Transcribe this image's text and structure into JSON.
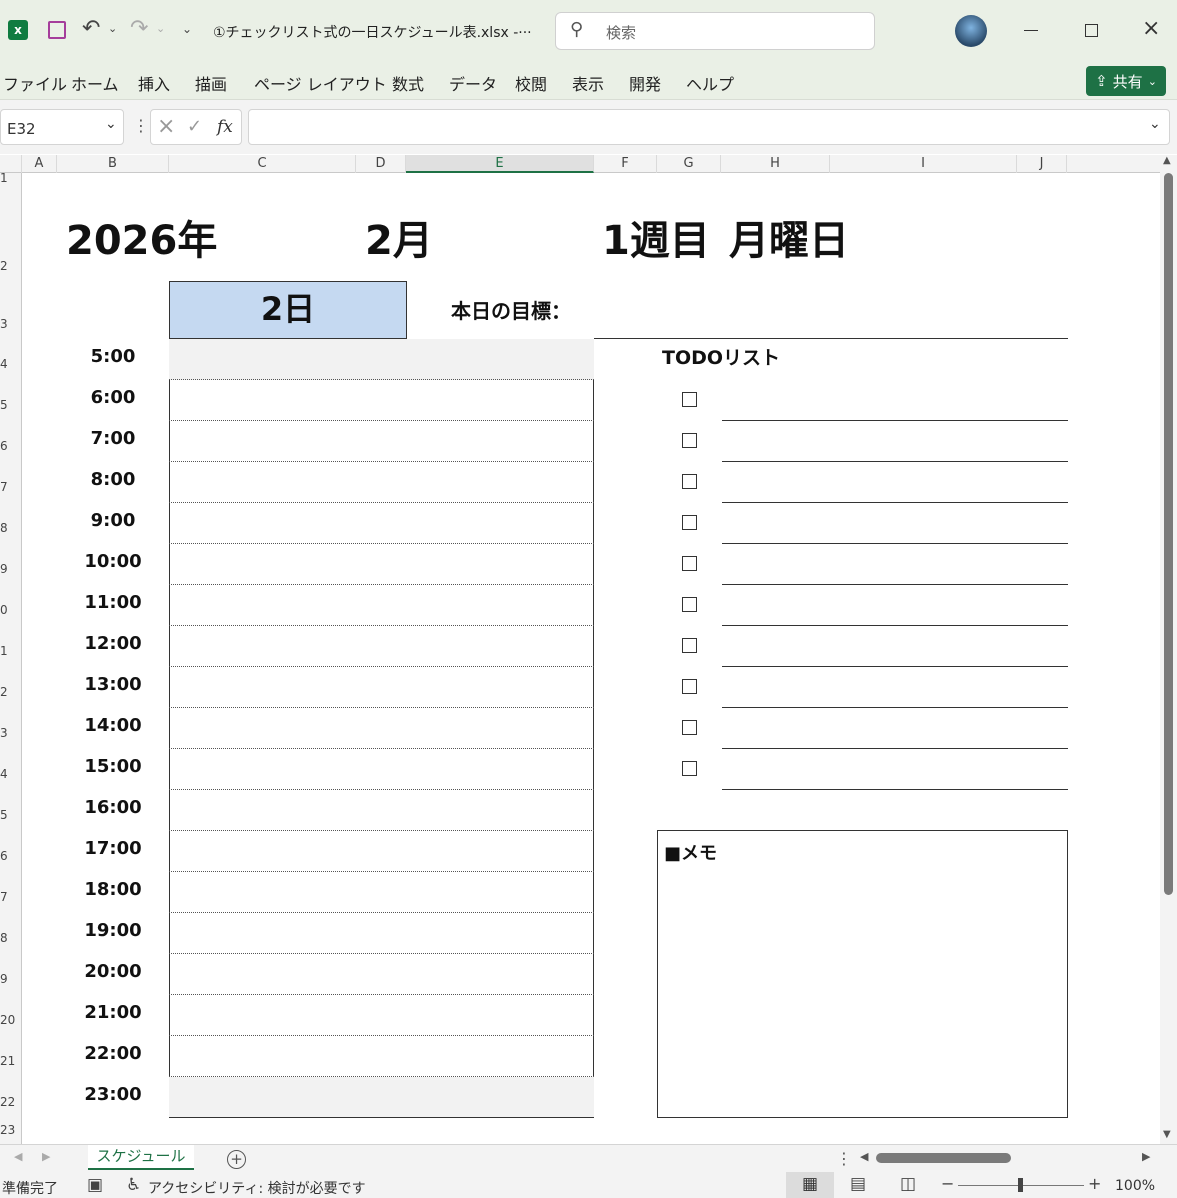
{
  "titlebar": {
    "filename": "①チェックリスト式の一日スケジュール表.xlsx  -···",
    "search_placeholder": "検索"
  },
  "menu": [
    "ファイル",
    "ホーム",
    "挿入",
    "描画",
    "ページ レイアウト",
    "数式",
    "データ",
    "校閲",
    "表示",
    "開発",
    "ヘルプ"
  ],
  "share_label": "共有",
  "formula": {
    "name_box": "E32",
    "fx": "fx"
  },
  "columns": [
    "A",
    "B",
    "C",
    "D",
    "E",
    "F",
    "G",
    "H",
    "I",
    "J"
  ],
  "rows": [
    "1",
    "2",
    "3",
    "4",
    "5",
    "6",
    "7",
    "8",
    "9",
    "0",
    "1",
    "2",
    "3",
    "4",
    "5",
    "6",
    "7",
    "8",
    "9",
    "20",
    "21",
    "22",
    "23"
  ],
  "header": {
    "year": "2026年",
    "month": "2月",
    "week": "1週目",
    "weekday": "月曜日",
    "day": "2日",
    "goal_label": "本日の目標："
  },
  "times": [
    "5:00",
    "6:00",
    "7:00",
    "8:00",
    "9:00",
    "10:00",
    "11:00",
    "12:00",
    "13:00",
    "14:00",
    "15:00",
    "16:00",
    "17:00",
    "18:00",
    "19:00",
    "20:00",
    "21:00",
    "22:00",
    "23:00"
  ],
  "todo": {
    "title": "TODOリスト",
    "count": 10
  },
  "memo_label": "■メモ",
  "sheet_tab": "スケジュール",
  "status": {
    "ready": "準備完了",
    "accessibility": "アクセシビリティ: 検討が必要です",
    "zoom": "100%"
  },
  "colors": {
    "accent": "#1e7145",
    "day_fill": "#c5d9f1",
    "shade": "#f2f2f2"
  }
}
